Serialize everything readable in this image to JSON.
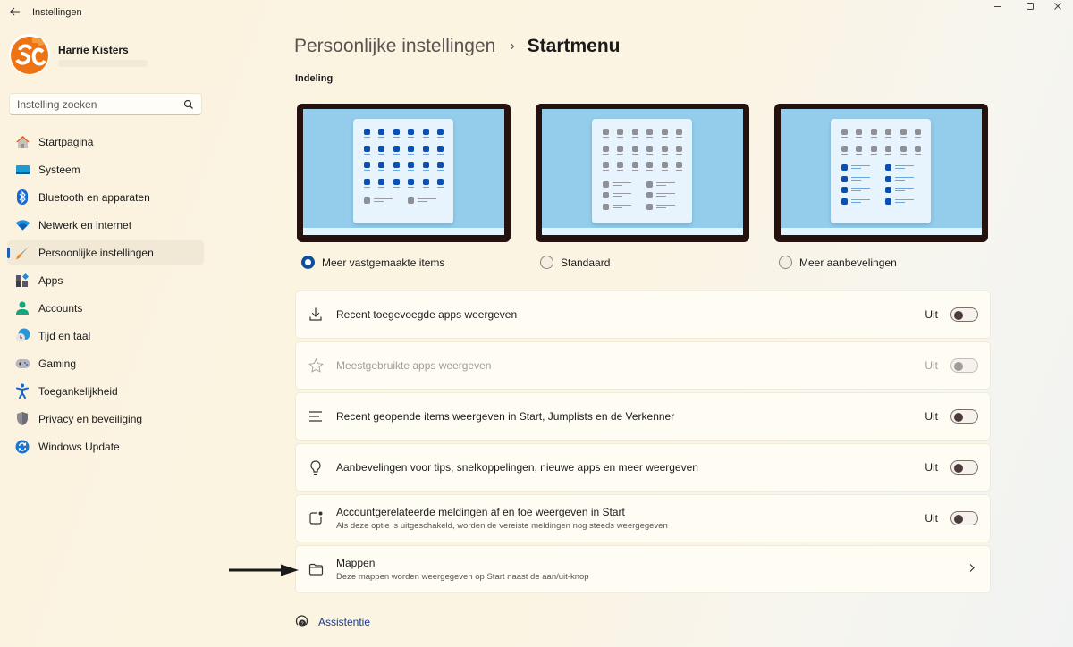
{
  "window": {
    "title": "Instellingen",
    "controls": [
      "minimize",
      "maximize",
      "close"
    ]
  },
  "profile": {
    "name": "Harrie Kisters",
    "avatar_colors": {
      "primary": "#ee7312",
      "secondary": "#ffffff"
    }
  },
  "search": {
    "placeholder": "Instelling zoeken",
    "value": ""
  },
  "sidebar": {
    "items": [
      {
        "label": "Startpagina",
        "icon": "home-icon",
        "active": false
      },
      {
        "label": "Systeem",
        "icon": "system-icon",
        "active": false
      },
      {
        "label": "Bluetooth en apparaten",
        "icon": "bluetooth-icon",
        "active": false
      },
      {
        "label": "Netwerk en internet",
        "icon": "wifi-icon",
        "active": false
      },
      {
        "label": "Persoonlijke instellingen",
        "icon": "brush-icon",
        "active": true
      },
      {
        "label": "Apps",
        "icon": "apps-icon",
        "active": false
      },
      {
        "label": "Accounts",
        "icon": "account-icon",
        "active": false
      },
      {
        "label": "Tijd en taal",
        "icon": "time-language-icon",
        "active": false
      },
      {
        "label": "Gaming",
        "icon": "gamepad-icon",
        "active": false
      },
      {
        "label": "Toegankelijkheid",
        "icon": "accessibility-icon",
        "active": false
      },
      {
        "label": "Privacy en beveiliging",
        "icon": "shield-icon",
        "active": false
      },
      {
        "label": "Windows Update",
        "icon": "update-icon",
        "active": false
      }
    ]
  },
  "breadcrumb": {
    "parent": "Persoonlijke instellingen",
    "separator": "›",
    "current": "Startmenu"
  },
  "layout_section": {
    "label": "Indeling",
    "options": [
      {
        "label": "Meer vastgemaakte items",
        "selected": true,
        "pinned_rows": 4,
        "recommended_rows": 1
      },
      {
        "label": "Standaard",
        "selected": false,
        "pinned_rows": 3,
        "recommended_rows": 3
      },
      {
        "label": "Meer aanbevelingen",
        "selected": false,
        "pinned_rows": 2,
        "recommended_rows": 4
      }
    ]
  },
  "settings": [
    {
      "icon": "download-icon",
      "title": "Recent toegevoegde apps weergeven",
      "description": "",
      "state_label": "Uit",
      "toggle": false,
      "disabled": false
    },
    {
      "icon": "star-icon",
      "title": "Meestgebruikte apps weergeven",
      "description": "",
      "state_label": "Uit",
      "toggle": false,
      "disabled": true
    },
    {
      "icon": "list-icon",
      "title": "Recent geopende items weergeven in Start, Jumplists en de Verkenner",
      "description": "",
      "state_label": "Uit",
      "toggle": false,
      "disabled": false
    },
    {
      "icon": "lightbulb-icon",
      "title": "Aanbevelingen voor tips, snelkoppelingen, nieuwe apps en meer weergeven",
      "description": "",
      "state_label": "Uit",
      "toggle": false,
      "disabled": false
    },
    {
      "icon": "notification-icon",
      "title": "Accountgerelateerde meldingen af en toe weergeven in Start",
      "description": "Als deze optie is uitgeschakeld, worden de vereiste meldingen nog steeds weergegeven",
      "state_label": "Uit",
      "toggle": false,
      "disabled": false
    },
    {
      "icon": "folder-icon",
      "title": "Mappen",
      "description": "Deze mappen worden weergegeven op Start naast de aan/uit-knop",
      "navigates": true
    }
  ],
  "assist": {
    "label": "Assistentie"
  },
  "colors": {
    "accent": "#0e4f9c",
    "tile_blue": "#0a4fb5",
    "tile_gray": "#8f8f96",
    "link": "#1a3b8c"
  }
}
